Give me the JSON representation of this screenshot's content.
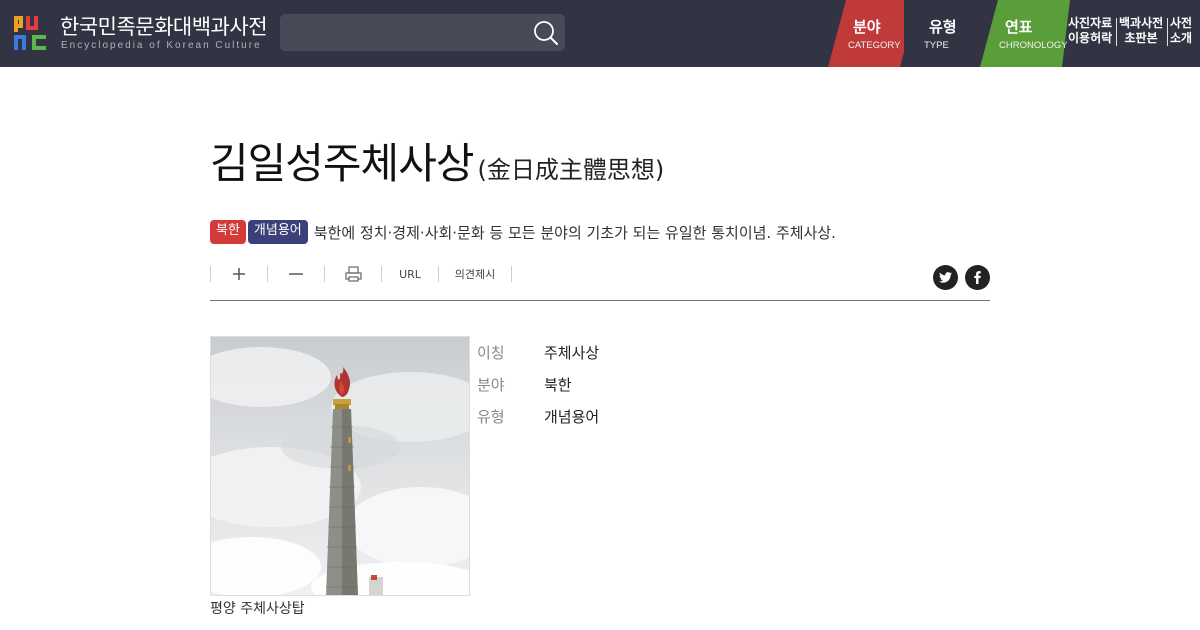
{
  "header": {
    "site_title": "한국민족문화대백과사전",
    "site_subtitle": "Encyclopedia of Korean Culture",
    "search": {
      "placeholder": "",
      "value": ""
    },
    "nav_tabs": [
      {
        "label": "분야",
        "sub": "CATEGORY",
        "color": "#c03a3a"
      },
      {
        "label": "유형",
        "sub": "TYPE"
      },
      {
        "label": "연표",
        "sub": "CHRONOLOGY",
        "color": "#5a9e3a"
      }
    ],
    "util_links": [
      {
        "line1": "사진자료",
        "line2": "이용허락"
      },
      {
        "line1": "백과사전",
        "line2": "초판본"
      },
      {
        "line1": "사전",
        "line2": "소개"
      }
    ]
  },
  "article": {
    "title": "김일성주체사상",
    "title_hanja": "(金日成主體思想)",
    "badges": [
      {
        "label": "북한",
        "color": "#d43a3a"
      },
      {
        "label": "개념용어",
        "color": "#3b3f7a"
      }
    ],
    "summary": "북한에 정치·경제·사회·문화 등 모든 분야의 기초가 되는 유일한 통치이념.   주체사상.",
    "toolbar": {
      "zoom_in_icon": "plus-icon",
      "zoom_out_icon": "minus-icon",
      "print_icon": "print-icon",
      "url_label": "URL",
      "feedback_label": "의견제시"
    },
    "share": [
      "twitter-icon",
      "facebook-icon"
    ],
    "photo_caption": "평양 주체사상탑",
    "info": [
      {
        "key": "이칭",
        "value": "주체사상"
      },
      {
        "key": "분야",
        "value": "북한"
      },
      {
        "key": "유형",
        "value": "개념용어"
      }
    ]
  }
}
